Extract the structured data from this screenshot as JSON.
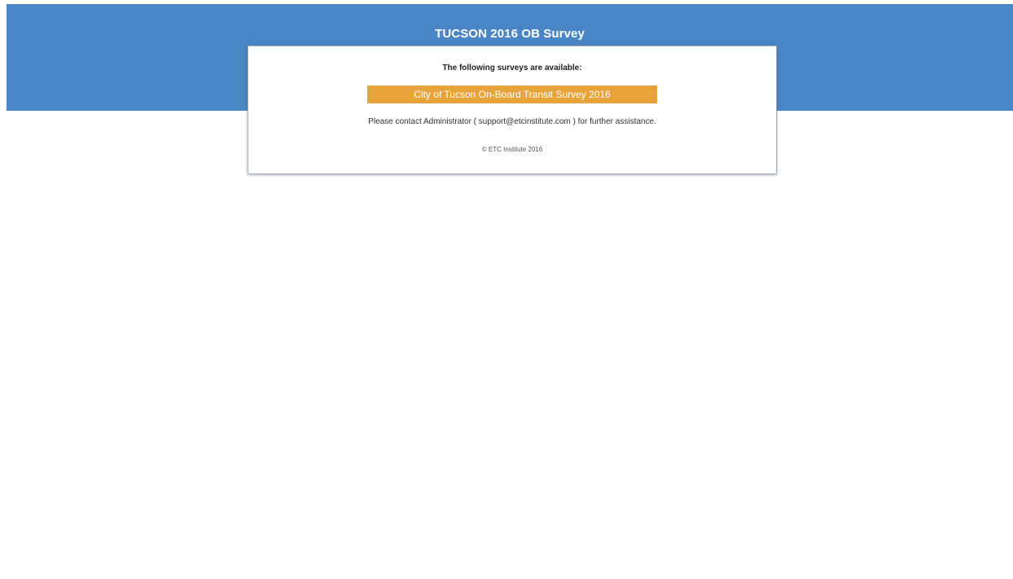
{
  "header": {
    "title": "TUCSON 2016 OB Survey"
  },
  "card": {
    "heading": "The following surveys are available:",
    "survey_link_label": "City of Tucson On-Board Transit Survey 2016",
    "contact_text": "Please contact Administrator ( support@etcinstitute.com ) for further assistance.",
    "copyright": "© ETC Institute 2016"
  },
  "colors": {
    "header_band": "#4a86c5",
    "survey_button": "#e8a33a"
  }
}
